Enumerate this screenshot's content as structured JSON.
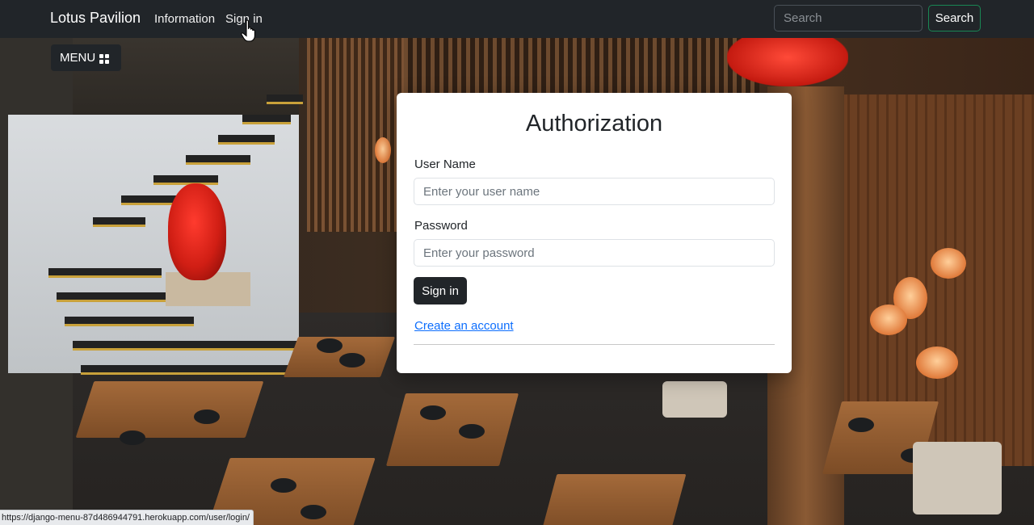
{
  "navbar": {
    "brand": "Lotus Pavilion",
    "links": [
      {
        "label": "Information"
      },
      {
        "label": "Sign in"
      }
    ],
    "search": {
      "placeholder": "Search",
      "value": "",
      "button_label": "Search"
    }
  },
  "menu_button": {
    "label": "MENU",
    "icon": "grid-icon"
  },
  "auth_card": {
    "title": "Authorization",
    "username": {
      "label": "User Name",
      "placeholder": "Enter your user name",
      "value": ""
    },
    "password": {
      "label": "Password",
      "placeholder": "Enter your password",
      "value": ""
    },
    "submit_label": "Sign in",
    "create_account_label": "Create an account"
  },
  "status_bar": {
    "url": "https://django-menu-87d486944791.herokuapp.com/user/login/"
  },
  "colors": {
    "navbar_bg": "#212529",
    "search_button_border": "#198754",
    "link_blue": "#0d6efd",
    "sign_in_button": "#212529"
  },
  "icons": [
    "grid-icon",
    "hand-pointer-icon"
  ]
}
